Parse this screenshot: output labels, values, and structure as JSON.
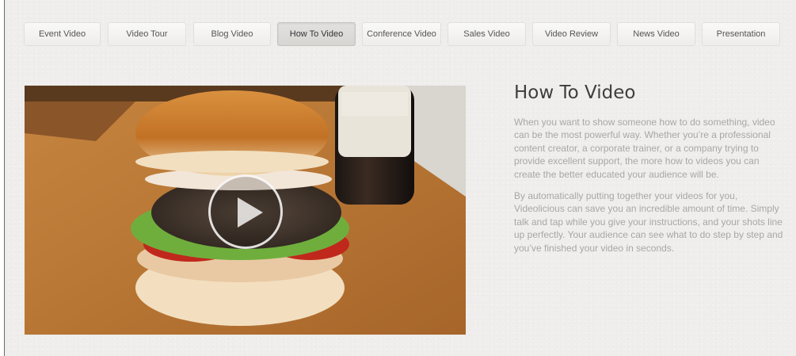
{
  "tabs": [
    {
      "label": "Event Video",
      "active": false
    },
    {
      "label": "Video Tour",
      "active": false
    },
    {
      "label": "Blog Video",
      "active": false
    },
    {
      "label": "How To Video",
      "active": true
    },
    {
      "label": "Conference Video",
      "active": false
    },
    {
      "label": "Sales Video",
      "active": false
    },
    {
      "label": "Video Review",
      "active": false
    },
    {
      "label": "News Video",
      "active": false
    },
    {
      "label": "Presentation",
      "active": false
    }
  ],
  "video": {
    "play_icon": "play-icon"
  },
  "content": {
    "title": "How To Video",
    "paragraphs": [
      "When you want to show someone how to do something, video can be the most powerful way. Whether you’re a professional content creator, a corporate trainer, or a company trying to provide excellent support, the more how to videos you can create the better educated your audience will be.",
      "By automatically putting together your videos for you, Videolicious can save you an incredible amount of time. Simply talk and tap while you give your instructions, and your shots line up perfectly. Your audience can see what to do step by step and you’ve finished your video in seconds."
    ]
  },
  "colors": {
    "background": "#efeeec",
    "title": "#3e3e3e",
    "body_text": "#a7a7a7"
  }
}
